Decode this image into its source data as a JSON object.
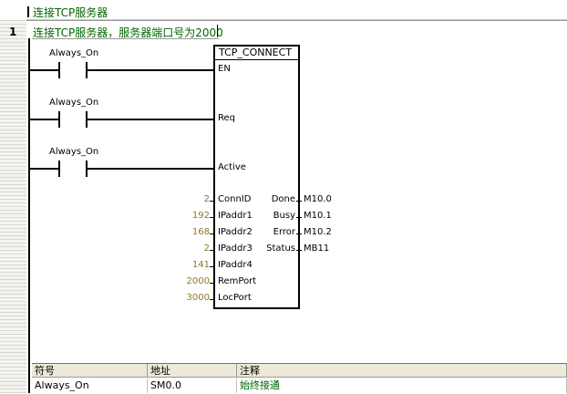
{
  "network": {
    "title": "连接TCP服务器",
    "number": "1",
    "comment": "连接TCP服务器，服务器端口号为2000"
  },
  "contacts": [
    {
      "label": "Always_On"
    },
    {
      "label": "Always_On"
    },
    {
      "label": "Always_On"
    }
  ],
  "block": {
    "name": "TCP_CONNECT",
    "en": "EN",
    "req": "Req",
    "active": "Active",
    "inputs": [
      {
        "pin": "ConnID",
        "value": "2"
      },
      {
        "pin": "IPaddr1",
        "value": "192"
      },
      {
        "pin": "IPaddr2",
        "value": "168"
      },
      {
        "pin": "IPaddr3",
        "value": "2"
      },
      {
        "pin": "IPaddr4",
        "value": "141"
      },
      {
        "pin": "RemPort",
        "value": "2000"
      },
      {
        "pin": "LocPort",
        "value": "3000"
      }
    ],
    "outputs": [
      {
        "pin": "Done",
        "value": "M10.0"
      },
      {
        "pin": "Busy",
        "value": "M10.1"
      },
      {
        "pin": "Error",
        "value": "M10.2"
      },
      {
        "pin": "Status",
        "value": "MB11"
      }
    ]
  },
  "symbol_table": {
    "headers": [
      "符号",
      "地址",
      "注释"
    ],
    "rows": [
      {
        "symbol": "Always_On",
        "address": "SM0.0",
        "comment": "始终接通"
      }
    ]
  },
  "colors": {
    "comment_green": "#006600",
    "constant_olive": "#8a7a2a"
  }
}
